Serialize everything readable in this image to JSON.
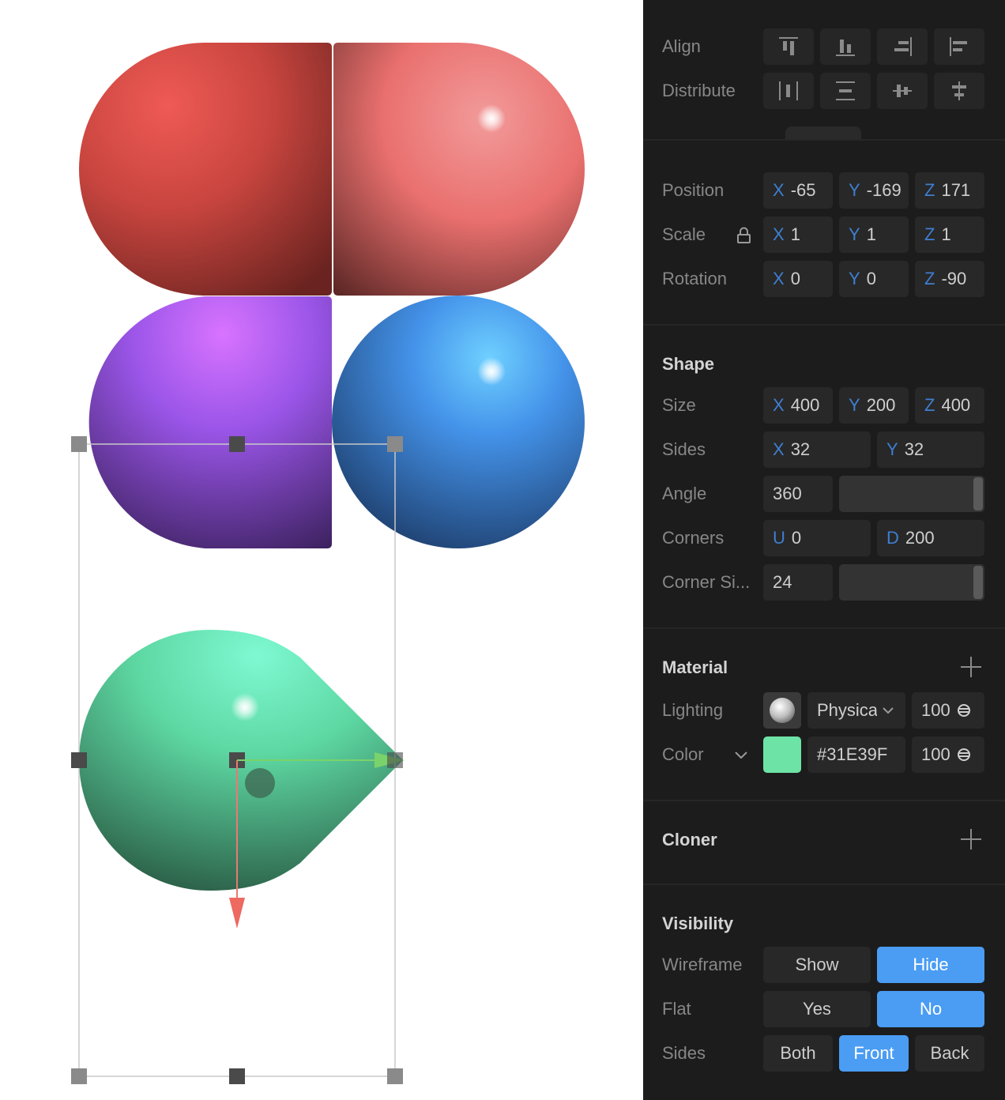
{
  "viewport": {
    "shapes": [
      {
        "name": "red-left-capsule-half",
        "color": "#e8514c"
      },
      {
        "name": "red-right-capsule-half",
        "color": "#f08a8a"
      },
      {
        "name": "purple-capsule-half",
        "color": "#b366ff"
      },
      {
        "name": "blue-sphere",
        "color": "#4aa1f5"
      },
      {
        "name": "green-teardrop",
        "color": "#31E39F"
      }
    ]
  },
  "panel": {
    "align_label": "Align",
    "distribute_label": "Distribute",
    "align_icons": [
      "align-top-icon",
      "align-bottom-icon",
      "align-right-icon",
      "align-left-icon"
    ],
    "distribute_icons": [
      "distribute-horizontal-icon",
      "distribute-center-horizontal-icon",
      "distribute-vertical-icon",
      "distribute-center-vertical-icon"
    ],
    "transform": {
      "position": {
        "label": "Position",
        "x": "-65",
        "y": "-169",
        "z": "171"
      },
      "scale": {
        "label": "Scale",
        "x": "1",
        "y": "1",
        "z": "1",
        "lock_icon": "lock-icon"
      },
      "rotation": {
        "label": "Rotation",
        "x": "0",
        "y": "0",
        "z": "-90"
      },
      "axis_x": "X",
      "axis_y": "Y",
      "axis_z": "Z"
    },
    "shape": {
      "title": "Shape",
      "size": {
        "label": "Size",
        "x": "400",
        "y": "200",
        "z": "400"
      },
      "sides": {
        "label": "Sides",
        "x": "32",
        "y": "32"
      },
      "angle": {
        "label": "Angle",
        "value": "360"
      },
      "corners": {
        "label": "Corners",
        "u_axis": "U",
        "u": "0",
        "d_axis": "D",
        "d": "200"
      },
      "corner_size": {
        "label": "Corner Si...",
        "value": "24"
      }
    },
    "material": {
      "title": "Material",
      "lighting": {
        "label": "Lighting",
        "mode": "Physical",
        "opacity": "100"
      },
      "color": {
        "label": "Color",
        "hex": "#31E39F",
        "swatch": "#6ee3a6",
        "opacity": "100"
      }
    },
    "cloner": {
      "title": "Cloner"
    },
    "visibility": {
      "title": "Visibility",
      "wireframe": {
        "label": "Wireframe",
        "options": [
          "Show",
          "Hide"
        ],
        "selected": "Hide"
      },
      "flat": {
        "label": "Flat",
        "options": [
          "Yes",
          "No"
        ],
        "selected": "No"
      },
      "sides": {
        "label": "Sides",
        "options": [
          "Both",
          "Front",
          "Back"
        ],
        "selected": "Front"
      }
    },
    "colors": {
      "accent": "#4a9df3",
      "panel_bg": "#1c1c1c",
      "field_bg": "#282828",
      "axis": "#3e7fd2"
    }
  }
}
